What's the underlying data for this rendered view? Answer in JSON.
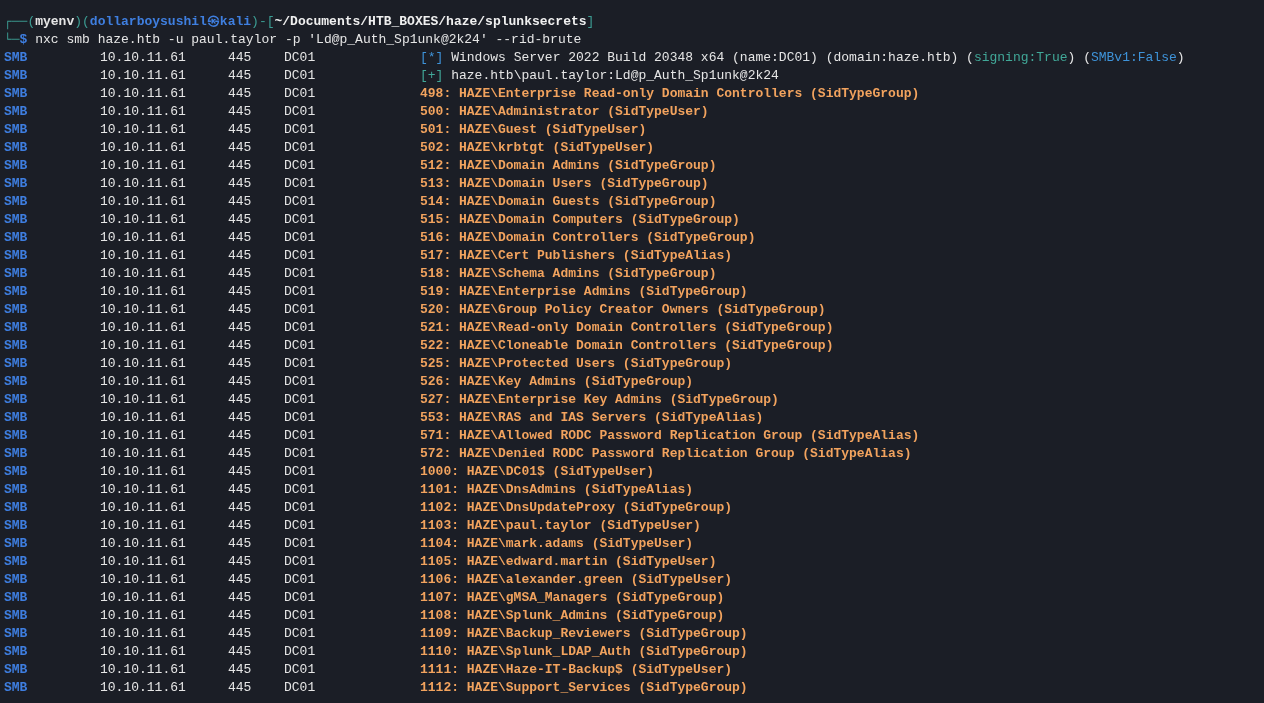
{
  "prompt": {
    "segments": [
      {
        "text": "┌──(",
        "kind": "frame"
      },
      {
        "text": "myenv",
        "kind": "env"
      },
      {
        "text": ")(",
        "kind": "frame"
      },
      {
        "text": "dollarboysushil㉿kali",
        "kind": "user"
      },
      {
        "text": ")-[",
        "kind": "frame"
      },
      {
        "text": "~/Documents/HTB_BOXES/haze/splunksecrets",
        "kind": "path"
      },
      {
        "text": "]",
        "kind": "frame"
      }
    ]
  },
  "command": {
    "corner": "└─",
    "symbol": "$",
    "text": "nxc smb haze.htb -u paul.taylor -p 'Ld@p_Auth_Sp1unk@2k24' --rid-brute"
  },
  "rows": [
    {
      "protocol": "SMB",
      "host": "10.10.11.61",
      "port": "445",
      "name": "DC01",
      "kind": "info",
      "marker": "[*]",
      "segments": [
        {
          "text": "Windows Server 2022 Build 20348 x64 (name:DC01) (domain:haze.htb) (",
          "kind": "plain"
        },
        {
          "text": "signing:True",
          "kind": "teal"
        },
        {
          "text": ") (",
          "kind": "plain"
        },
        {
          "text": "SMBv1:False",
          "kind": "blue"
        },
        {
          "text": ")",
          "kind": "plain"
        }
      ]
    },
    {
      "protocol": "SMB",
      "host": "10.10.11.61",
      "port": "445",
      "name": "DC01",
      "kind": "success",
      "marker": "[+]",
      "segments": [
        {
          "text": "haze.htb\\paul.taylor:Ld@p_Auth_Sp1unk@2k24",
          "kind": "plain"
        }
      ]
    },
    {
      "protocol": "SMB",
      "host": "10.10.11.61",
      "port": "445",
      "name": "DC01",
      "kind": "rid",
      "text": "498: HAZE\\Enterprise Read-only Domain Controllers (SidTypeGroup)"
    },
    {
      "protocol": "SMB",
      "host": "10.10.11.61",
      "port": "445",
      "name": "DC01",
      "kind": "rid",
      "text": "500: HAZE\\Administrator (SidTypeUser)"
    },
    {
      "protocol": "SMB",
      "host": "10.10.11.61",
      "port": "445",
      "name": "DC01",
      "kind": "rid",
      "text": "501: HAZE\\Guest (SidTypeUser)"
    },
    {
      "protocol": "SMB",
      "host": "10.10.11.61",
      "port": "445",
      "name": "DC01",
      "kind": "rid",
      "text": "502: HAZE\\krbtgt (SidTypeUser)"
    },
    {
      "protocol": "SMB",
      "host": "10.10.11.61",
      "port": "445",
      "name": "DC01",
      "kind": "rid",
      "text": "512: HAZE\\Domain Admins (SidTypeGroup)"
    },
    {
      "protocol": "SMB",
      "host": "10.10.11.61",
      "port": "445",
      "name": "DC01",
      "kind": "rid",
      "text": "513: HAZE\\Domain Users (SidTypeGroup)"
    },
    {
      "protocol": "SMB",
      "host": "10.10.11.61",
      "port": "445",
      "name": "DC01",
      "kind": "rid",
      "text": "514: HAZE\\Domain Guests (SidTypeGroup)"
    },
    {
      "protocol": "SMB",
      "host": "10.10.11.61",
      "port": "445",
      "name": "DC01",
      "kind": "rid",
      "text": "515: HAZE\\Domain Computers (SidTypeGroup)"
    },
    {
      "protocol": "SMB",
      "host": "10.10.11.61",
      "port": "445",
      "name": "DC01",
      "kind": "rid",
      "text": "516: HAZE\\Domain Controllers (SidTypeGroup)"
    },
    {
      "protocol": "SMB",
      "host": "10.10.11.61",
      "port": "445",
      "name": "DC01",
      "kind": "rid",
      "text": "517: HAZE\\Cert Publishers (SidTypeAlias)"
    },
    {
      "protocol": "SMB",
      "host": "10.10.11.61",
      "port": "445",
      "name": "DC01",
      "kind": "rid",
      "text": "518: HAZE\\Schema Admins (SidTypeGroup)"
    },
    {
      "protocol": "SMB",
      "host": "10.10.11.61",
      "port": "445",
      "name": "DC01",
      "kind": "rid",
      "text": "519: HAZE\\Enterprise Admins (SidTypeGroup)"
    },
    {
      "protocol": "SMB",
      "host": "10.10.11.61",
      "port": "445",
      "name": "DC01",
      "kind": "rid",
      "text": "520: HAZE\\Group Policy Creator Owners (SidTypeGroup)"
    },
    {
      "protocol": "SMB",
      "host": "10.10.11.61",
      "port": "445",
      "name": "DC01",
      "kind": "rid",
      "text": "521: HAZE\\Read-only Domain Controllers (SidTypeGroup)"
    },
    {
      "protocol": "SMB",
      "host": "10.10.11.61",
      "port": "445",
      "name": "DC01",
      "kind": "rid",
      "text": "522: HAZE\\Cloneable Domain Controllers (SidTypeGroup)"
    },
    {
      "protocol": "SMB",
      "host": "10.10.11.61",
      "port": "445",
      "name": "DC01",
      "kind": "rid",
      "text": "525: HAZE\\Protected Users (SidTypeGroup)"
    },
    {
      "protocol": "SMB",
      "host": "10.10.11.61",
      "port": "445",
      "name": "DC01",
      "kind": "rid",
      "text": "526: HAZE\\Key Admins (SidTypeGroup)"
    },
    {
      "protocol": "SMB",
      "host": "10.10.11.61",
      "port": "445",
      "name": "DC01",
      "kind": "rid",
      "text": "527: HAZE\\Enterprise Key Admins (SidTypeGroup)"
    },
    {
      "protocol": "SMB",
      "host": "10.10.11.61",
      "port": "445",
      "name": "DC01",
      "kind": "rid",
      "text": "553: HAZE\\RAS and IAS Servers (SidTypeAlias)"
    },
    {
      "protocol": "SMB",
      "host": "10.10.11.61",
      "port": "445",
      "name": "DC01",
      "kind": "rid",
      "text": "571: HAZE\\Allowed RODC Password Replication Group (SidTypeAlias)"
    },
    {
      "protocol": "SMB",
      "host": "10.10.11.61",
      "port": "445",
      "name": "DC01",
      "kind": "rid",
      "text": "572: HAZE\\Denied RODC Password Replication Group (SidTypeAlias)"
    },
    {
      "protocol": "SMB",
      "host": "10.10.11.61",
      "port": "445",
      "name": "DC01",
      "kind": "rid",
      "text": "1000: HAZE\\DC01$ (SidTypeUser)"
    },
    {
      "protocol": "SMB",
      "host": "10.10.11.61",
      "port": "445",
      "name": "DC01",
      "kind": "rid",
      "text": "1101: HAZE\\DnsAdmins (SidTypeAlias)"
    },
    {
      "protocol": "SMB",
      "host": "10.10.11.61",
      "port": "445",
      "name": "DC01",
      "kind": "rid",
      "text": "1102: HAZE\\DnsUpdateProxy (SidTypeGroup)"
    },
    {
      "protocol": "SMB",
      "host": "10.10.11.61",
      "port": "445",
      "name": "DC01",
      "kind": "rid",
      "text": "1103: HAZE\\paul.taylor (SidTypeUser)"
    },
    {
      "protocol": "SMB",
      "host": "10.10.11.61",
      "port": "445",
      "name": "DC01",
      "kind": "rid",
      "text": "1104: HAZE\\mark.adams (SidTypeUser)"
    },
    {
      "protocol": "SMB",
      "host": "10.10.11.61",
      "port": "445",
      "name": "DC01",
      "kind": "rid",
      "text": "1105: HAZE\\edward.martin (SidTypeUser)"
    },
    {
      "protocol": "SMB",
      "host": "10.10.11.61",
      "port": "445",
      "name": "DC01",
      "kind": "rid",
      "text": "1106: HAZE\\alexander.green (SidTypeUser)"
    },
    {
      "protocol": "SMB",
      "host": "10.10.11.61",
      "port": "445",
      "name": "DC01",
      "kind": "rid",
      "text": "1107: HAZE\\gMSA_Managers (SidTypeGroup)"
    },
    {
      "protocol": "SMB",
      "host": "10.10.11.61",
      "port": "445",
      "name": "DC01",
      "kind": "rid",
      "text": "1108: HAZE\\Splunk_Admins (SidTypeGroup)"
    },
    {
      "protocol": "SMB",
      "host": "10.10.11.61",
      "port": "445",
      "name": "DC01",
      "kind": "rid",
      "text": "1109: HAZE\\Backup_Reviewers (SidTypeGroup)"
    },
    {
      "protocol": "SMB",
      "host": "10.10.11.61",
      "port": "445",
      "name": "DC01",
      "kind": "rid",
      "text": "1110: HAZE\\Splunk_LDAP_Auth (SidTypeGroup)"
    },
    {
      "protocol": "SMB",
      "host": "10.10.11.61",
      "port": "445",
      "name": "DC01",
      "kind": "rid",
      "text": "1111: HAZE\\Haze-IT-Backup$ (SidTypeUser)"
    },
    {
      "protocol": "SMB",
      "host": "10.10.11.61",
      "port": "445",
      "name": "DC01",
      "kind": "rid",
      "text": "1112: HAZE\\Support_Services (SidTypeGroup)"
    }
  ]
}
